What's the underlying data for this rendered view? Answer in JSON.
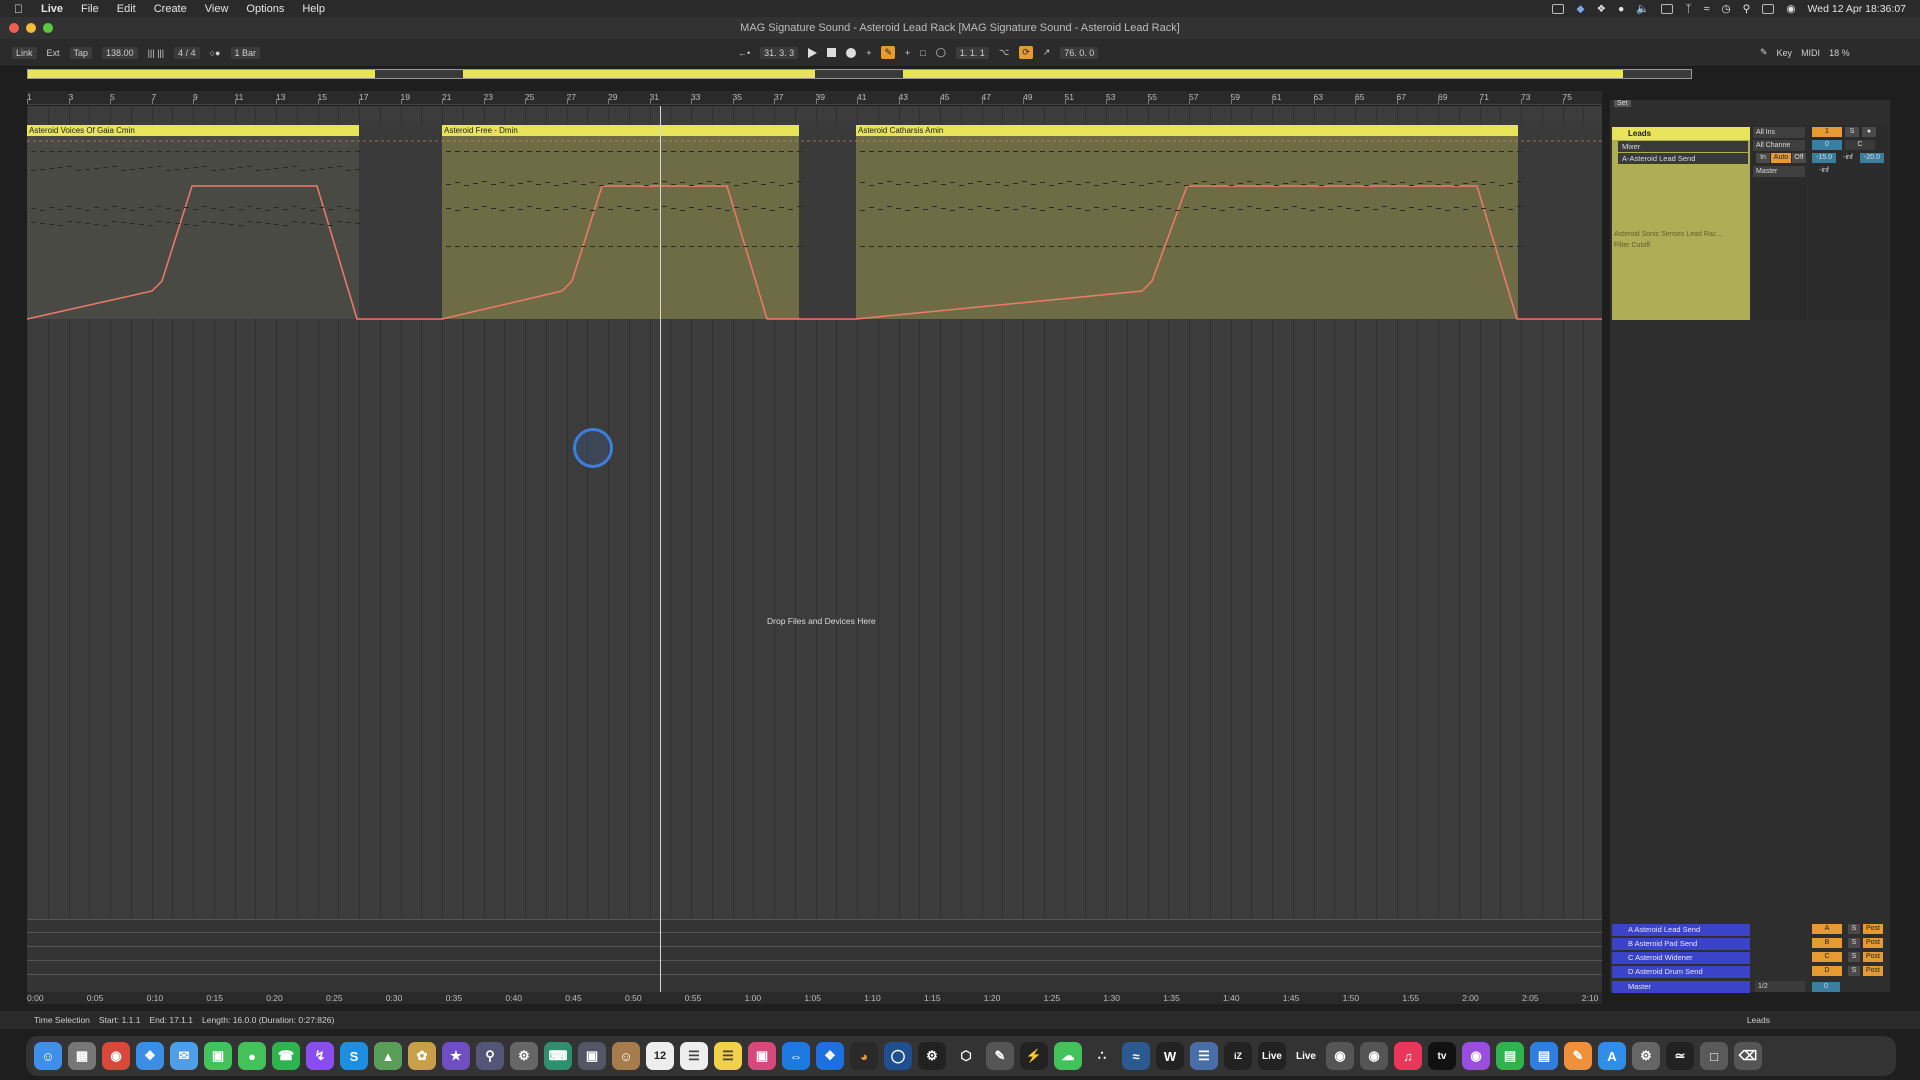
{
  "menubar": {
    "apple": "",
    "menus": [
      "Live",
      "File",
      "Edit",
      "Create",
      "View",
      "Options",
      "Help"
    ],
    "clock": "Wed 12 Apr  18:36:07"
  },
  "window": {
    "title": "MAG Signature Sound - Asteroid Lead Rack  [MAG Signature Sound - Asteroid Lead Rack]"
  },
  "control_bar": {
    "link": "Link",
    "ext": "Ext",
    "tap": "Tap",
    "tempo": "138.00",
    "time_sig": "4 / 4",
    "quantize": "1 Bar",
    "position": "31.  3.  3",
    "loop_start": "1.  1.  1",
    "loop_length": "76.  0.  0",
    "key": "Key",
    "midi": "MIDI",
    "cpu": "18 %"
  },
  "ruler": {
    "bars": [
      "1",
      "3",
      "5",
      "7",
      "9",
      "11",
      "13",
      "15",
      "17",
      "19",
      "21",
      "23",
      "25",
      "27",
      "29",
      "31",
      "33",
      "35",
      "37",
      "39",
      "41",
      "43",
      "45",
      "47",
      "49",
      "51",
      "53",
      "55",
      "57",
      "59",
      "61",
      "63",
      "65",
      "67",
      "69",
      "71",
      "73",
      "75"
    ]
  },
  "clips": [
    {
      "name": "Asteroid Voices Of Gaia Cmin"
    },
    {
      "name": "Asteroid Free - Dmin"
    },
    {
      "name": "Asteroid Catharsis Amin"
    }
  ],
  "arrangement": {
    "drop_hint": "Drop Files and Devices Here"
  },
  "track": {
    "set_label": "Set",
    "name": "Leads",
    "device_chooser": "Mixer",
    "param_chooser": "A-Asteroid Lead Send",
    "automation_device": "Asteroid Sonic Senses Lead Rac...",
    "automation_param": "Filter Cutoff",
    "input_type": "All Ins",
    "input_channel": "All Channe",
    "monitor_in": "In",
    "monitor_auto": "Auto",
    "monitor_off": "Off",
    "output": "Master",
    "track_number": "1",
    "solo": "S",
    "send_a": "0",
    "pan": "C",
    "volume": "-15.0",
    "peak": "-inf",
    "send_val": "-20.0",
    "meter_val": "-inf"
  },
  "returns": [
    {
      "name": "A Asteroid Lead Send",
      "letter": "A",
      "solo": "S",
      "post": "Post"
    },
    {
      "name": "B Asteroid Pad Send",
      "letter": "B",
      "solo": "S",
      "post": "Post"
    },
    {
      "name": "C Asteroid Widener",
      "letter": "C",
      "solo": "S",
      "post": "Post"
    },
    {
      "name": "D Asteroid Drum Send",
      "letter": "D",
      "solo": "S",
      "post": "Post"
    }
  ],
  "master": {
    "name": "Master",
    "output": "1/2",
    "value": "0"
  },
  "time_ruler": [
    "0:00",
    "0:05",
    "0:10",
    "0:15",
    "0:20",
    "0:25",
    "0:30",
    "0:35",
    "0:40",
    "0:45",
    "0:50",
    "0:55",
    "1:00",
    "1:05",
    "1:10",
    "1:15",
    "1:20",
    "1:25",
    "1:30",
    "1:35",
    "1:40",
    "1:45",
    "1:50",
    "1:55",
    "2:00",
    "2:05",
    "2:10"
  ],
  "status": {
    "label": "Time Selection",
    "start": "Start: 1.1.1",
    "end": "End: 17.1.1",
    "length": "Length: 16.0.0  (Duration: 0:27:826)",
    "track": "Leads"
  },
  "dock": {
    "calendar_day": "12",
    "live_1": "Live",
    "live_2": "Live",
    "tv": "tv"
  },
  "colors": {
    "clip_yellow": "#e7e45a",
    "automation": "#f07a6a",
    "return_blue": "#3b44c8",
    "accent_orange": "#e59b32"
  }
}
